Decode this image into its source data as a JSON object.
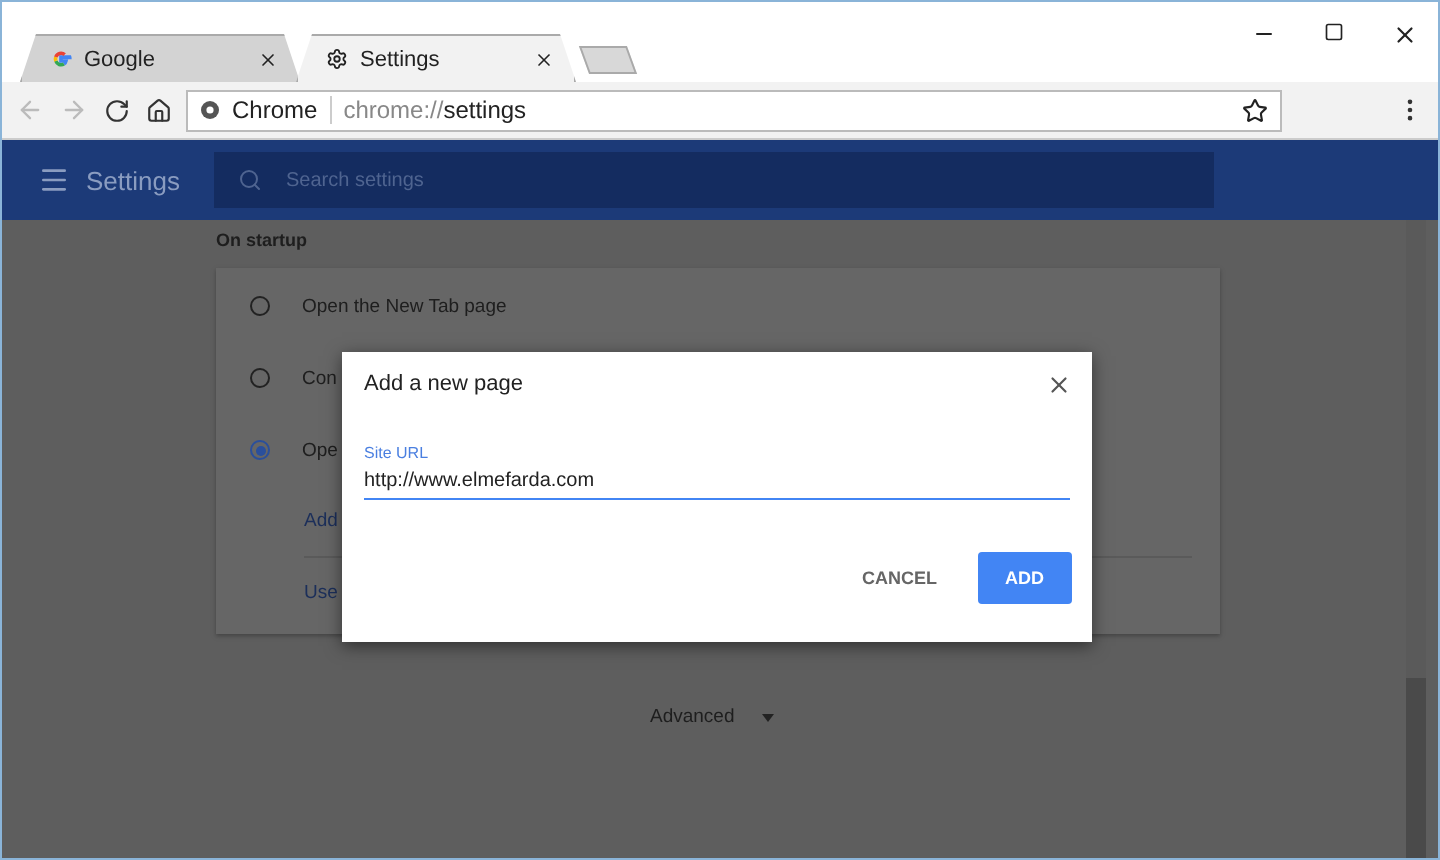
{
  "tabs": [
    {
      "title": "Google",
      "selected": false
    },
    {
      "title": "Settings",
      "selected": true
    }
  ],
  "toolbar": {
    "origin": "Chrome",
    "url": {
      "scheme": "chrome://",
      "path": "settings"
    }
  },
  "header": {
    "title": "Settings",
    "search": {
      "placeholder": "Search settings"
    }
  },
  "section": {
    "title": "On startup",
    "options": [
      {
        "label": "Open the New Tab page",
        "selected": false
      },
      {
        "label": "Con",
        "selected": false
      },
      {
        "label": "Ope",
        "selected": true
      }
    ],
    "links": [
      "Add",
      "Use"
    ]
  },
  "advanced": {
    "label": "Advanced"
  },
  "dialog": {
    "title": "Add a new page",
    "field": {
      "label": "Site URL",
      "value": "http://www.elmefarda.com"
    },
    "buttons": [
      {
        "label": "CANCEL",
        "kind": "text"
      },
      {
        "label": "ADD",
        "kind": "primary"
      }
    ]
  }
}
